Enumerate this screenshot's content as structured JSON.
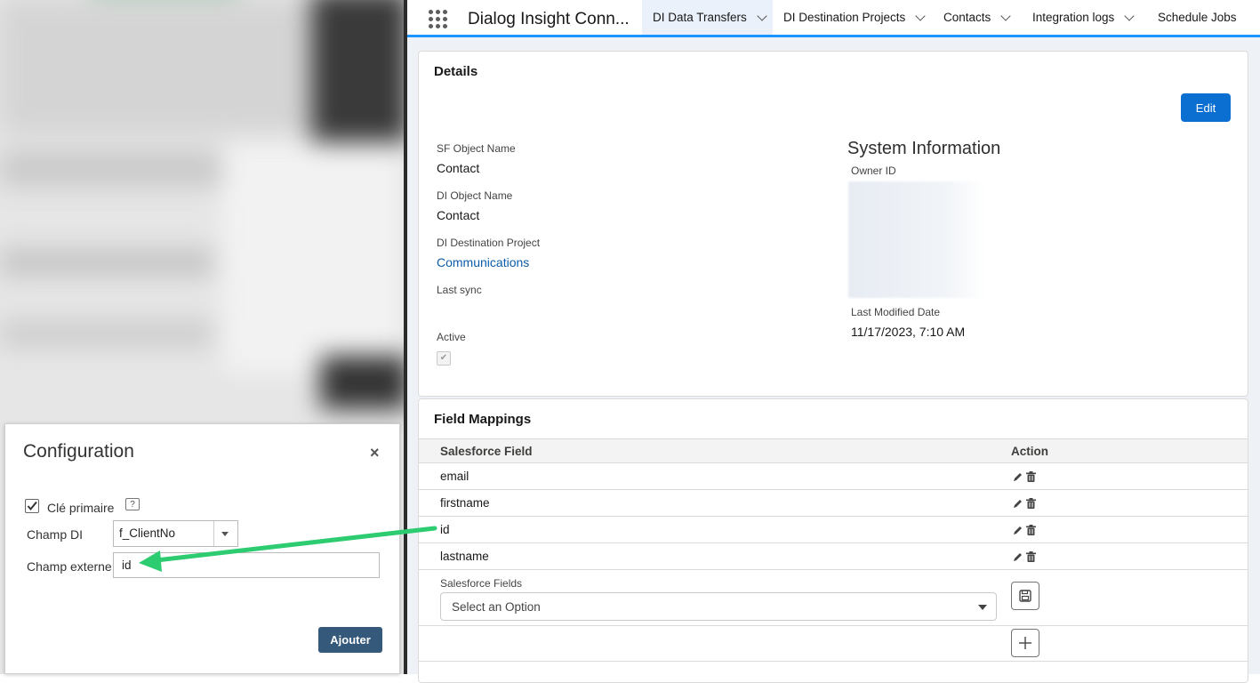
{
  "nav": {
    "app_name": "Dialog Insight Conn...",
    "tabs": [
      {
        "label": "DI Data Transfers"
      },
      {
        "label": "DI Destination Projects"
      },
      {
        "label": "Contacts"
      },
      {
        "label": "Integration logs"
      },
      {
        "label": "Schedule Jobs"
      }
    ]
  },
  "details": {
    "title": "Details",
    "edit_label": "Edit",
    "fields": {
      "sf_object_name_label": "SF Object Name",
      "sf_object_name_value": "Contact",
      "di_object_name_label": "DI Object Name",
      "di_object_name_value": "Contact",
      "di_destination_project_label": "DI Destination Project",
      "di_destination_project_value": "Communications",
      "last_sync_label": "Last sync",
      "active_label": "Active",
      "active_checked": true
    },
    "system_information": {
      "title": "System Information",
      "owner_id_label": "Owner ID",
      "last_modified_label": "Last Modified Date",
      "last_modified_value": "11/17/2023, 7:10 AM"
    }
  },
  "field_mappings": {
    "title": "Field Mappings",
    "columns": [
      "Salesforce Field",
      "Action"
    ],
    "rows": [
      {
        "field": "email"
      },
      {
        "field": "firstname"
      },
      {
        "field": "id"
      },
      {
        "field": "lastname"
      }
    ],
    "salesforce_fields_label": "Salesforce Fields",
    "select_placeholder": "Select an Option"
  },
  "config_dialog": {
    "title": "Configuration",
    "close_symbol": "×",
    "primary_key_label": "Clé primaire",
    "primary_key_checked": true,
    "help_symbol": "?",
    "di_field_label": "Champ DI",
    "di_field_value": "f_ClientNo",
    "external_field_label": "Champ externe",
    "external_field_value": "id",
    "submit_label": "Ajouter"
  },
  "colors": {
    "sf_brand_blue": "#0b6fd1",
    "nav_active_underline": "#1b96ff",
    "annotation_arrow": "#2ecc71",
    "dialog_button": "#35597a"
  }
}
